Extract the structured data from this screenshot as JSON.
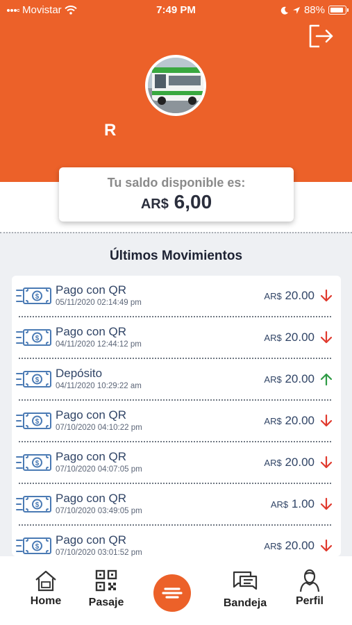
{
  "status_bar": {
    "carrier": "Movistar",
    "time": "7:49 PM",
    "battery": "88%"
  },
  "profile": {
    "initial": "R"
  },
  "balance": {
    "label": "Tu saldo disponible es:",
    "currency": "AR$",
    "amount": "6,00"
  },
  "movements": {
    "title": "Últimos Movimientos",
    "items": [
      {
        "title": "Pago con QR",
        "date": "05/11/2020 02:14:49 pm",
        "currency": "AR$",
        "amount": "20.00",
        "direction": "down"
      },
      {
        "title": "Pago con QR",
        "date": "04/11/2020 12:44:12 pm",
        "currency": "AR$",
        "amount": "20.00",
        "direction": "down"
      },
      {
        "title": "Depósito",
        "date": "04/11/2020 10:29:22 am",
        "currency": "AR$",
        "amount": "20.00",
        "direction": "up"
      },
      {
        "title": "Pago con QR",
        "date": "07/10/2020 04:10:22 pm",
        "currency": "AR$",
        "amount": "20.00",
        "direction": "down"
      },
      {
        "title": "Pago con QR",
        "date": "07/10/2020 04:07:05 pm",
        "currency": "AR$",
        "amount": "20.00",
        "direction": "down"
      },
      {
        "title": "Pago con QR",
        "date": "07/10/2020 03:49:05 pm",
        "currency": "AR$",
        "amount": "1.00",
        "direction": "down"
      },
      {
        "title": "Pago con QR",
        "date": "07/10/2020 03:01:52 pm",
        "currency": "AR$",
        "amount": "20.00",
        "direction": "down"
      }
    ]
  },
  "tabs": {
    "home": "Home",
    "pasaje": "Pasaje",
    "bandeja": "Bandeja",
    "perfil": "Perfil"
  },
  "colors": {
    "brand": "#ec6129",
    "down_arrow": "#e03a2e",
    "up_arrow": "#2e9b45",
    "text_dark": "#304466"
  },
  "icons": {
    "logout": "logout-icon",
    "avatar": "bus-avatar",
    "money": "money-bill-icon",
    "home": "home-icon",
    "pasaje": "qr-code-icon",
    "menu": "menu-icon",
    "bandeja": "chat-icon",
    "perfil": "user-icon"
  }
}
